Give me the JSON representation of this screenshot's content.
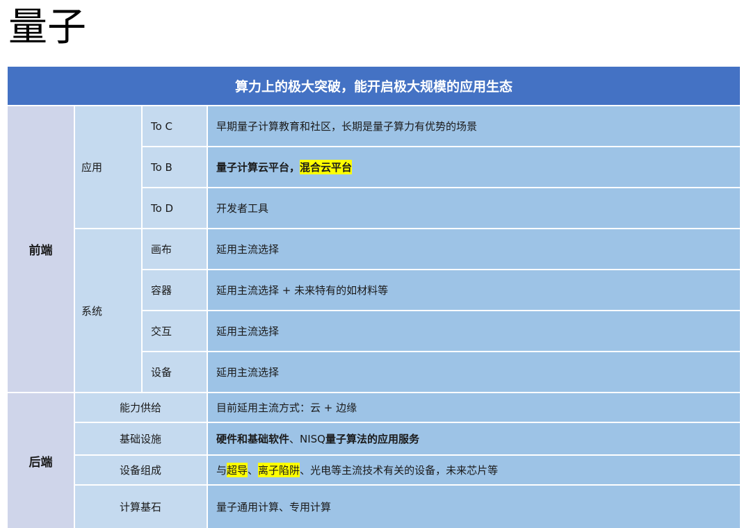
{
  "page_title": "量子",
  "header": "算力上的极大突破，能开启极大规模的应用生态",
  "frontend": {
    "label": "前端",
    "groups": [
      {
        "label": "应用",
        "rows": [
          {
            "name": "To C",
            "desc": "早期量子计算教育和社区，长期是量子算力有优势的场景"
          },
          {
            "name": "To B",
            "desc_part1": "量子计算云平台，",
            "desc_highlight": "混合云平台"
          },
          {
            "name": "To D",
            "desc": "开发者工具"
          }
        ]
      },
      {
        "label": "系统",
        "rows": [
          {
            "name": "画布",
            "desc": "延用主流选择"
          },
          {
            "name": "容器",
            "desc": "延用主流选择 + 未来特有的如材料等"
          },
          {
            "name": "交互",
            "desc": "延用主流选择"
          },
          {
            "name": "设备",
            "desc": "延用主流选择"
          }
        ]
      }
    ]
  },
  "backend": {
    "label": "后端",
    "rows": [
      {
        "name": "能力供给",
        "desc": "目前延用主流方式：云 + 边缘"
      },
      {
        "name": "基础设施",
        "desc_bold1": "硬件和基础软件",
        "desc_mid": "、NISQ ",
        "desc_bold2": "量子算法的应用服务"
      },
      {
        "name": "设备组成",
        "desc_a": "与",
        "desc_hl1": "超导",
        "desc_b": "、",
        "desc_hl2": "离子陷阱",
        "desc_c": "、光电等主流技术有关的设备，未来芯片等"
      },
      {
        "name": "计算基石",
        "desc": "量子通用计算、专用计算"
      }
    ]
  },
  "colors": {
    "header": "#4472c4",
    "section": "#cfd5ea",
    "label": "#c5daef",
    "desc": "#9dc3e6",
    "highlight": "#ffff00"
  }
}
